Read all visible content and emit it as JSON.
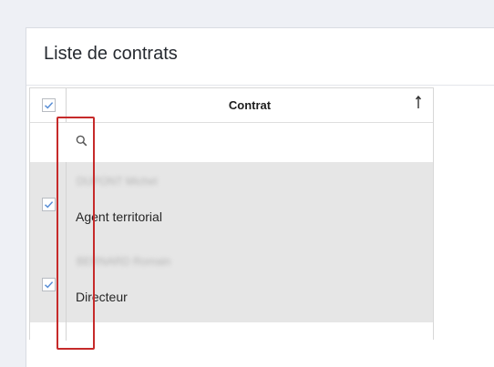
{
  "panel": {
    "title": "Liste de contrats"
  },
  "grid": {
    "column_header": "Contrat",
    "header_selected": true,
    "filter": {
      "value": "",
      "icon": "search-icon"
    },
    "rows": [
      {
        "name_blurred": "DUPONT Michel",
        "contract": "Agent territorial",
        "selected": true
      },
      {
        "name_blurred": "BERNARD Romain",
        "contract": "Directeur",
        "selected": true
      }
    ]
  },
  "icons": {
    "sort": "sort-ascending-icon",
    "check": "checkmark-icon"
  },
  "colors": {
    "checkmark": "#5a8fd6",
    "highlight": "#c62a2a",
    "selected_row": "#e6e6e6"
  }
}
